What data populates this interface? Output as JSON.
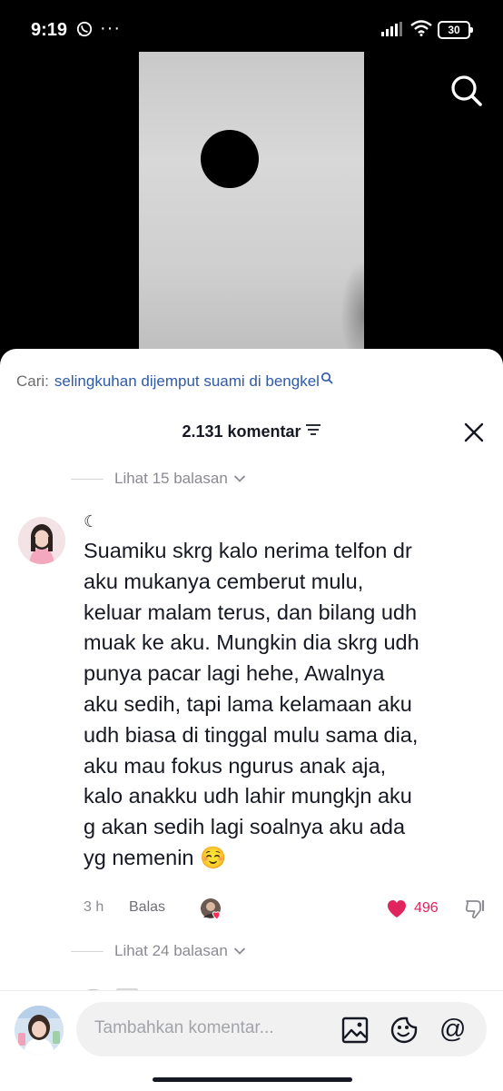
{
  "status_bar": {
    "time": "9:19",
    "more": "···",
    "battery": "30"
  },
  "search_bar": {
    "label": "Cari:",
    "query": "selingkuhan dijemput suami di bengkel"
  },
  "comments_header": {
    "count": "2.131 komentar"
  },
  "thread_top": {
    "replies_label": "Lihat 15 balasan"
  },
  "comment": {
    "username": "☾",
    "text_lines": [
      "Suamiku skrg kalo nerima telfon dr",
      "aku mukanya cemberut mulu,",
      "keluar malam terus, dan bilang udh",
      "muak ke aku. Mungkin dia skrg udh",
      "punya pacar lagi hehe, Awalnya",
      "aku sedih, tapi lama kelamaan aku",
      "udh biasa di tinggal mulu sama dia,",
      "aku mau fokus ngurus anak aja,",
      "kalo anakku udh lahir mungkjn aku",
      "g akan sedih lagi soalnya aku ada",
      "yg nemenin ☺️"
    ],
    "time_ago": "3 h",
    "reply_label": "Balas",
    "likes": "496",
    "replies_label": "Lihat 24 balasan"
  },
  "composer": {
    "placeholder": "Tambahkan komentar..."
  },
  "colors": {
    "accent_link": "#2f5aa7",
    "like_red": "#e0245e",
    "muted": "#8a8b91"
  }
}
